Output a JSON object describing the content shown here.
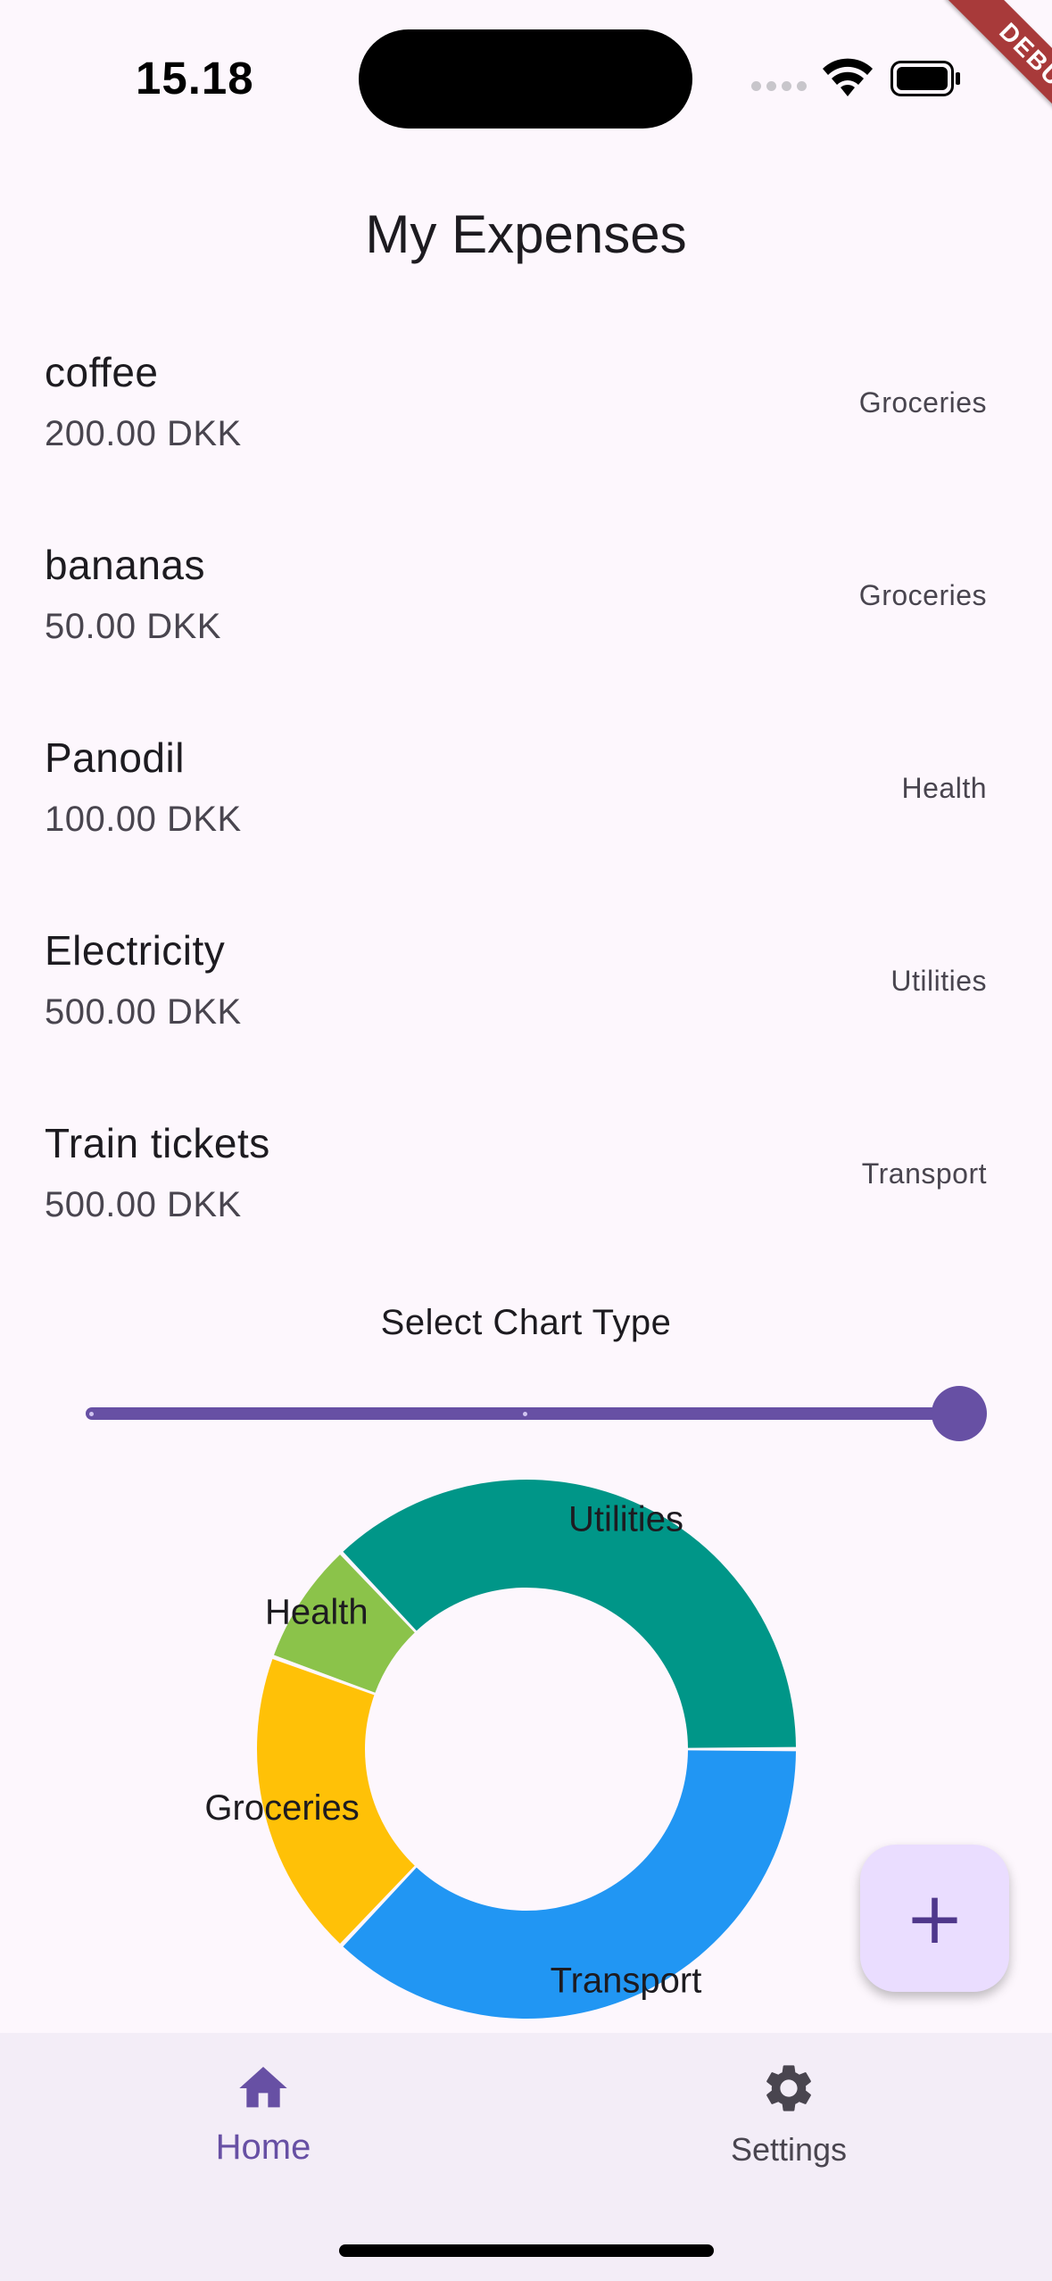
{
  "status_bar": {
    "time": "15.18",
    "icons": [
      "cellular-signal-icon",
      "wifi-icon",
      "battery-icon"
    ]
  },
  "debug_banner": {
    "label": "DEBUG"
  },
  "app_bar": {
    "title": "My Expenses"
  },
  "expenses": [
    {
      "name": "coffee",
      "amount": "200.00 DKK",
      "category": "Groceries"
    },
    {
      "name": "bananas",
      "amount": "50.00 DKK",
      "category": "Groceries"
    },
    {
      "name": "Panodil",
      "amount": "100.00 DKK",
      "category": "Health"
    },
    {
      "name": "Electricity",
      "amount": "500.00 DKK",
      "category": "Utilities"
    },
    {
      "name": "Train tickets",
      "amount": "500.00 DKK",
      "category": "Transport"
    }
  ],
  "chart_selector": {
    "label": "Select Chart Type",
    "slider_value": 1.0,
    "divisions": 2
  },
  "chart_data": {
    "type": "pie",
    "donut": true,
    "categories": [
      "Transport",
      "Groceries",
      "Health",
      "Utilities"
    ],
    "values": [
      500,
      250,
      100,
      500
    ],
    "colors": [
      "#2196f3",
      "#ffc107",
      "#8bc34a",
      "#009688"
    ]
  },
  "fab": {
    "icon": "add-icon",
    "label": "+"
  },
  "bottom_nav": {
    "items": [
      {
        "label": "Home",
        "icon": "home-icon",
        "selected": true
      },
      {
        "label": "Settings",
        "icon": "gear-icon",
        "selected": false
      }
    ]
  },
  "colors": {
    "primary": "#6750a4",
    "background": "#fdf7fd",
    "fab_background": "#eaddff",
    "nav_background": "#f3edf7"
  }
}
